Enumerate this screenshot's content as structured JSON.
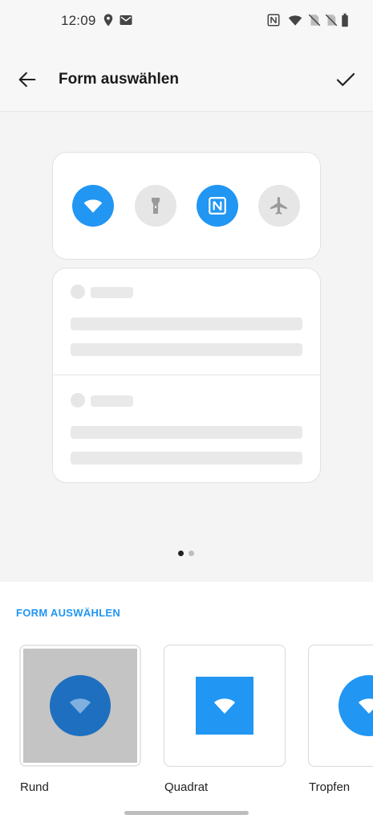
{
  "status_bar": {
    "time": "12:09",
    "left_icons": [
      "location-icon",
      "mail-icon"
    ],
    "right_icons": [
      "nfc-icon",
      "wifi-icon",
      "no-sim-icon",
      "no-sim-icon",
      "battery-icon"
    ]
  },
  "toolbar": {
    "title": "Form auswählen",
    "back_icon": "arrow-left-icon",
    "confirm_icon": "check-icon"
  },
  "preview": {
    "quick_tiles": [
      {
        "icon": "wifi-icon",
        "active": true
      },
      {
        "icon": "flashlight-icon",
        "active": false
      },
      {
        "icon": "nfc-icon",
        "active": true
      },
      {
        "icon": "airplane-icon",
        "active": false
      }
    ],
    "page_indicator": {
      "pages": 2,
      "current": 1
    }
  },
  "shape_section": {
    "heading": "FORM AUSWÄHLEN",
    "options": [
      {
        "label": "Rund",
        "selected": true
      },
      {
        "label": "Quadrat",
        "selected": false
      },
      {
        "label": "Tropfen",
        "selected": false
      }
    ]
  },
  "colors": {
    "accent": "#2196f3",
    "accent_dark": "#1e6fbf",
    "inactive_tile": "#e6e6e6",
    "selected_bg": "#c4c4c4"
  }
}
